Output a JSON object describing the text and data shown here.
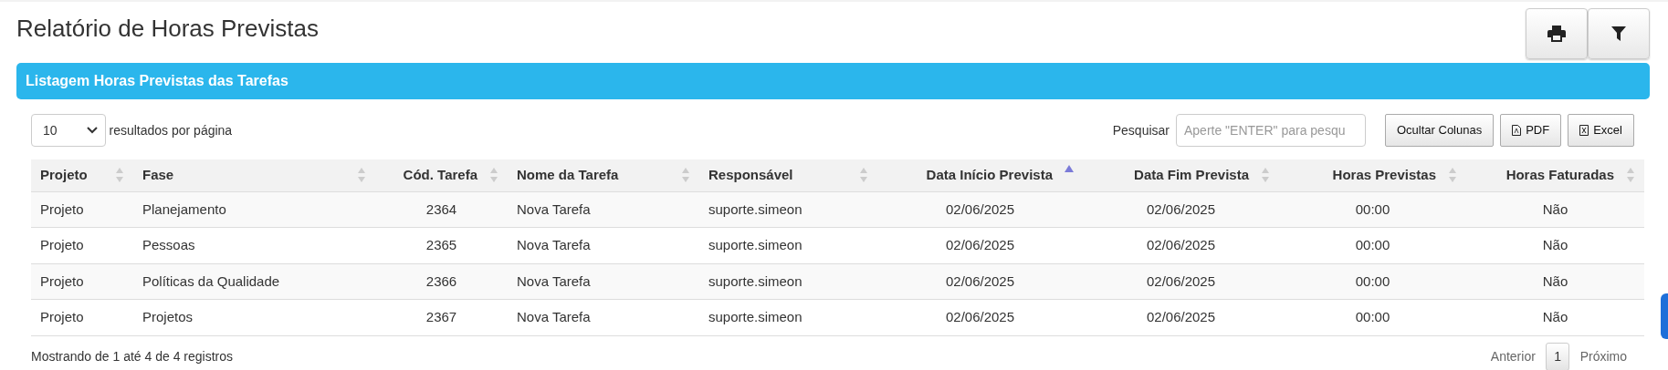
{
  "title": "Relatório de Horas Previstas",
  "toolbar": [
    {
      "kind": "print"
    },
    {
      "kind": "filter"
    }
  ],
  "panel": {
    "title": "Listagem Horas Previstas das Tarefas"
  },
  "page_size": {
    "value": "10",
    "label": "resultados por página"
  },
  "search": {
    "label": "Pesquisar",
    "placeholder": "Aperte \"ENTER\" para pesqu"
  },
  "buttons": [
    {
      "kind": "text",
      "label": "Ocultar Colunas"
    },
    {
      "kind": "pdf",
      "label": "PDF"
    },
    {
      "kind": "excel",
      "label": "Excel"
    }
  ],
  "table": {
    "columns": [
      {
        "label": "Projeto",
        "sorted": false
      },
      {
        "label": "Fase",
        "sorted": false
      },
      {
        "label": "Cód. Tarefa",
        "sorted": false
      },
      {
        "label": "Nome da Tarefa",
        "sorted": false
      },
      {
        "label": "Responsável",
        "sorted": false
      },
      {
        "label": "Data Início Prevista",
        "sorted": true
      },
      {
        "label": "Data Fim Prevista",
        "sorted": false
      },
      {
        "label": "Horas Previstas",
        "sorted": false
      },
      {
        "label": "Horas Faturadas",
        "sorted": false
      }
    ],
    "rows": [
      [
        "Projeto",
        "Planejamento",
        "2364",
        "Nova Tarefa",
        "suporte.simeon",
        "02/06/2025",
        "02/06/2025",
        "00:00",
        "Não"
      ],
      [
        "Projeto",
        "Pessoas",
        "2365",
        "Nova Tarefa",
        "suporte.simeon",
        "02/06/2025",
        "02/06/2025",
        "00:00",
        "Não"
      ],
      [
        "Projeto",
        "Políticas da Qualidade",
        "2366",
        "Nova Tarefa",
        "suporte.simeon",
        "02/06/2025",
        "02/06/2025",
        "00:00",
        "Não"
      ],
      [
        "Projeto",
        "Projetos",
        "2367",
        "Nova Tarefa",
        "suporte.simeon",
        "02/06/2025",
        "02/06/2025",
        "00:00",
        "Não"
      ]
    ]
  },
  "info": "Mostrando de 1 até 4 de 4 registros",
  "pagination": [
    {
      "label": "Anterior",
      "selected": false
    },
    {
      "label": "1",
      "selected": true
    },
    {
      "label": "Próximo",
      "selected": false
    }
  ]
}
